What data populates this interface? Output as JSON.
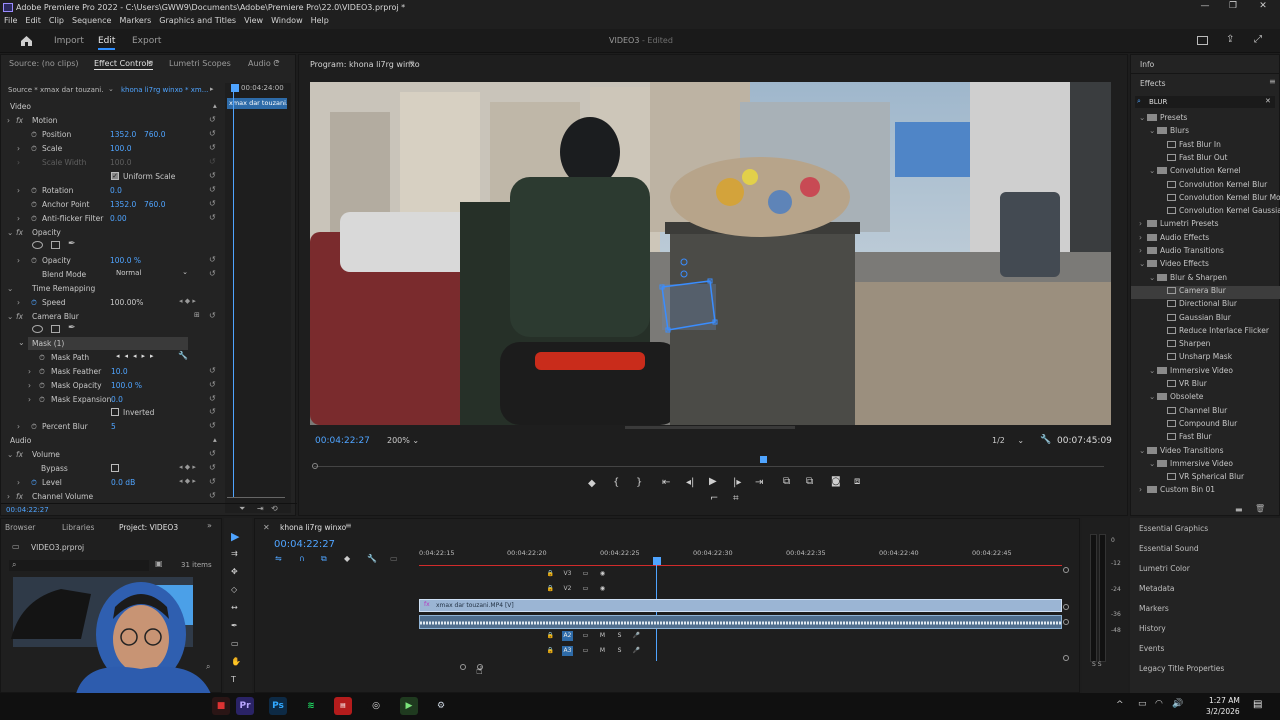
{
  "titlebar": {
    "title": "Adobe Premiere Pro 2022 - C:\\Users\\GWW9\\Documents\\Adobe\\Premiere Pro\\22.0\\VIDEO3.prproj *"
  },
  "menu": [
    "File",
    "Edit",
    "Clip",
    "Sequence",
    "Markers",
    "Graphics and Titles",
    "View",
    "Window",
    "Help"
  ],
  "nav": {
    "import": "Import",
    "edit": "Edit",
    "export": "Export",
    "project_title": "VIDEO3",
    "status": "- Edited"
  },
  "effect_controls": {
    "tabs": [
      "Source: (no clips)",
      "Effect Controls",
      "Lumetri Scopes",
      "Audio C"
    ],
    "source_clip": "Source * xmax dar touzani.",
    "sequence_clip": "khona li7rg winxo * xm...",
    "timeline_time": "00:04:24:00",
    "clip_bar_label": "xmax dar touzani.",
    "section_video": "Video",
    "motion": "Motion",
    "position_label": "Position",
    "position_x": "1352.0",
    "position_y": "760.0",
    "scale_label": "Scale",
    "scale_val": "100.0",
    "scale_width_label": "Scale Width",
    "scale_width_val": "100.0",
    "uniform_scale": "Uniform Scale",
    "rotation_label": "Rotation",
    "rotation_val": "0.0",
    "anchor_label": "Anchor Point",
    "anchor_x": "1352.0",
    "anchor_y": "760.0",
    "antiflicker_label": "Anti-flicker Filter",
    "antiflicker_val": "0.00",
    "opacity_section": "Opacity",
    "opacity_label": "Opacity",
    "opacity_val": "100.0 %",
    "blend_label": "Blend Mode",
    "blend_val": "Normal",
    "time_remap": "Time Remapping",
    "speed_label": "Speed",
    "speed_val": "100.00%",
    "camera_blur": "Camera Blur",
    "mask": "Mask (1)",
    "mask_path": "Mask Path",
    "mask_feather_label": "Mask Feather",
    "mask_feather_val": "10.0",
    "mask_opacity_label": "Mask Opacity",
    "mask_opacity_val": "100.0 %",
    "mask_expansion_label": "Mask Expansion",
    "mask_expansion_val": "0.0",
    "inverted": "Inverted",
    "percent_blur_label": "Percent Blur",
    "percent_blur_val": "5",
    "section_audio": "Audio",
    "volume": "Volume",
    "bypass": "Bypass",
    "level_label": "Level",
    "level_val": "0.0 dB",
    "channel_volume": "Channel Volume",
    "current_time": "00:04:22:27"
  },
  "program": {
    "title": "Program: khona li7rg winxo",
    "timecode": "00:04:22:27",
    "zoom": "200%",
    "quality": "1/2",
    "duration": "00:07:45:09"
  },
  "info_panel": {
    "title": "Info"
  },
  "effects_panel": {
    "title": "Effects",
    "search": "BLUR",
    "items": [
      {
        "label": "Presets",
        "level": 0,
        "kind": "folder"
      },
      {
        "label": "Blurs",
        "level": 1,
        "kind": "folder"
      },
      {
        "label": "Fast Blur In",
        "level": 2,
        "kind": "fx"
      },
      {
        "label": "Fast Blur Out",
        "level": 2,
        "kind": "fx"
      },
      {
        "label": "Convolution Kernel",
        "level": 1,
        "kind": "folder"
      },
      {
        "label": "Convolution Kernel Blur",
        "level": 2,
        "kind": "fx"
      },
      {
        "label": "Convolution Kernel Blur Mo",
        "level": 2,
        "kind": "fx"
      },
      {
        "label": "Convolution Kernel Gaussia",
        "level": 2,
        "kind": "fx"
      },
      {
        "label": "Lumetri Presets",
        "level": 0,
        "kind": "folder"
      },
      {
        "label": "Audio Effects",
        "level": 0,
        "kind": "folder"
      },
      {
        "label": "Audio Transitions",
        "level": 0,
        "kind": "folder"
      },
      {
        "label": "Video Effects",
        "level": 0,
        "kind": "folder"
      },
      {
        "label": "Blur & Sharpen",
        "level": 1,
        "kind": "folder"
      },
      {
        "label": "Camera Blur",
        "level": 2,
        "kind": "fx",
        "selected": true
      },
      {
        "label": "Directional Blur",
        "level": 2,
        "kind": "fx"
      },
      {
        "label": "Gaussian Blur",
        "level": 2,
        "kind": "fx"
      },
      {
        "label": "Reduce Interlace Flicker",
        "level": 2,
        "kind": "fx"
      },
      {
        "label": "Sharpen",
        "level": 2,
        "kind": "fx"
      },
      {
        "label": "Unsharp Mask",
        "level": 2,
        "kind": "fx"
      },
      {
        "label": "Immersive Video",
        "level": 1,
        "kind": "folder"
      },
      {
        "label": "VR Blur",
        "level": 2,
        "kind": "fx"
      },
      {
        "label": "Obsolete",
        "level": 1,
        "kind": "folder"
      },
      {
        "label": "Channel Blur",
        "level": 2,
        "kind": "fx"
      },
      {
        "label": "Compound Blur",
        "level": 2,
        "kind": "fx"
      },
      {
        "label": "Fast Blur",
        "level": 2,
        "kind": "fx"
      },
      {
        "label": "Video Transitions",
        "level": 0,
        "kind": "folder"
      },
      {
        "label": "Immersive Video",
        "level": 1,
        "kind": "folder"
      },
      {
        "label": "VR Spherical Blur",
        "level": 2,
        "kind": "fx"
      },
      {
        "label": "Custom Bin 01",
        "level": 0,
        "kind": "folder"
      }
    ],
    "side_panels": [
      "Essential Graphics",
      "Essential Sound",
      "Lumetri Color",
      "Metadata",
      "Markers",
      "History",
      "Events",
      "Legacy Title Properties"
    ]
  },
  "project_panel": {
    "tabs": [
      "Browser",
      "Libraries",
      "Project: VIDEO3"
    ],
    "file": "VIDEO3.prproj",
    "items_count": "31 items"
  },
  "timeline": {
    "tab": "khona li7rg winxo",
    "timecode": "00:04:22:27",
    "ruler": [
      "0:04:22:15",
      "00:04:22:20",
      "00:04:22:25",
      "00:04:22:30",
      "00:04:22:35",
      "00:04:22:40",
      "00:04:22:45"
    ],
    "tracks": [
      "V3",
      "V2",
      "V1",
      "A1",
      "A2",
      "A3"
    ],
    "clip_label": "xmax dar touzani.MP4 [V]",
    "meter_labels": [
      "0",
      "-12",
      "-24",
      "-36",
      "-48"
    ],
    "meter_solo": "S S"
  },
  "taskbar": {
    "time": "1:27 AM",
    "date": "3/2/2026"
  }
}
